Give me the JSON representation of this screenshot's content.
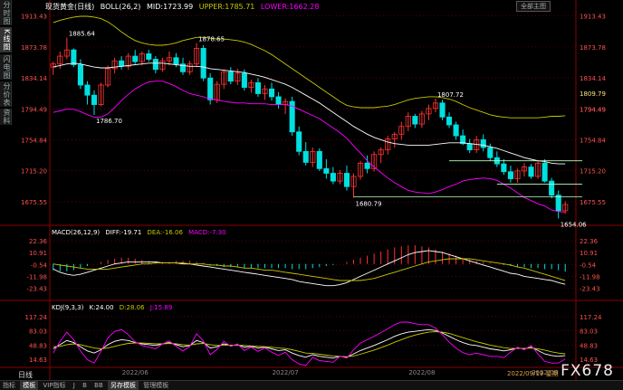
{
  "window": {
    "title": "现货黄金",
    "period": "日线",
    "main_button": "全部主图",
    "side_tabs": [
      "分时图",
      "K线图",
      "闪电图",
      "分价表",
      "资料"
    ],
    "watermark": "FX678",
    "cursor_date": "2022/09/19 星期"
  },
  "boll_header": {
    "name": "现货黄金(日线)",
    "params": "BOLL(26,2)",
    "mid": "MID:1723.99",
    "upper": "UPPER:1785.71",
    "lower": "LOWER:1662.28"
  },
  "macd_header": {
    "name": "MACD(26,12,9)",
    "diff": "DIFF:-19.71",
    "dea": "DEA:-16.06",
    "macd": "MACD:-7.30"
  },
  "kdj_header": {
    "name": "KDJ(9,3,3)",
    "k": "K:24.00",
    "d": "D:28.06",
    "j": "J:15.89"
  },
  "bottom_tabs": [
    "指标",
    "模板",
    "VIP指标",
    "J",
    "B",
    "BB",
    "另存模板",
    "管理模板"
  ],
  "colors": {
    "up": "#ff3333",
    "down": "#00e0e0",
    "mid": "#ffffff",
    "upper": "#c8c800",
    "lower": "#ff00ff",
    "grid": "#8b0000",
    "axis": "#ff5050"
  },
  "chart_data": [
    {
      "type": "candlestick",
      "title": "现货黄金(日线)",
      "ylim": [
        1650,
        1920
      ],
      "y_ticks": [
        1913.43,
        1873.78,
        1834.14,
        1794.49,
        1754.84,
        1715.2,
        1675.55
      ],
      "x_tick_labels": [
        "2022/06",
        "2022/07",
        "2022/08",
        "2022/09"
      ],
      "annotations": [
        {
          "label": "1885.64",
          "value": 1885.64
        },
        {
          "label": "1786.70",
          "value": 1786.7
        },
        {
          "label": "1878.65",
          "value": 1878.65
        },
        {
          "label": "1807.72",
          "value": 1807.72
        },
        {
          "label": "1680.79",
          "value": 1680.79
        },
        {
          "label": "1654.06",
          "value": 1654.06
        }
      ],
      "right_markers": [
        1809.79,
        1794.49
      ],
      "candles": [
        [
          1848,
          1855,
          1838,
          1852
        ],
        [
          1852,
          1868,
          1846,
          1862
        ],
        [
          1862,
          1885.64,
          1858,
          1870
        ],
        [
          1870,
          1872,
          1848,
          1851
        ],
        [
          1851,
          1858,
          1820,
          1825
        ],
        [
          1825,
          1830,
          1800,
          1812
        ],
        [
          1812,
          1818,
          1786.7,
          1800
        ],
        [
          1800,
          1828,
          1798,
          1825
        ],
        [
          1825,
          1850,
          1822,
          1846
        ],
        [
          1846,
          1860,
          1840,
          1856
        ],
        [
          1856,
          1862,
          1845,
          1849
        ],
        [
          1849,
          1866,
          1845,
          1862
        ],
        [
          1862,
          1870,
          1852,
          1855
        ],
        [
          1855,
          1868,
          1850,
          1865
        ],
        [
          1865,
          1870,
          1855,
          1858
        ],
        [
          1858,
          1862,
          1840,
          1845
        ],
        [
          1845,
          1860,
          1842,
          1856
        ],
        [
          1856,
          1868,
          1850,
          1860
        ],
        [
          1860,
          1866,
          1848,
          1852
        ],
        [
          1852,
          1860,
          1838,
          1842
        ],
        [
          1842,
          1856,
          1838,
          1852
        ],
        [
          1852,
          1878.65,
          1848,
          1872
        ],
        [
          1872,
          1876,
          1830,
          1834
        ],
        [
          1834,
          1840,
          1800,
          1806
        ],
        [
          1806,
          1830,
          1802,
          1826
        ],
        [
          1826,
          1845,
          1820,
          1842
        ],
        [
          1842,
          1848,
          1826,
          1830
        ],
        [
          1830,
          1846,
          1825,
          1840
        ],
        [
          1840,
          1845,
          1818,
          1822
        ],
        [
          1822,
          1832,
          1815,
          1828
        ],
        [
          1828,
          1834,
          1810,
          1814
        ],
        [
          1814,
          1825,
          1806,
          1820
        ],
        [
          1820,
          1828,
          1805,
          1810
        ],
        [
          1810,
          1816,
          1795,
          1800
        ],
        [
          1800,
          1808,
          1788,
          1804
        ],
        [
          1804,
          1810,
          1760,
          1765
        ],
        [
          1765,
          1772,
          1735,
          1740
        ],
        [
          1740,
          1752,
          1722,
          1726
        ],
        [
          1726,
          1745,
          1720,
          1740
        ],
        [
          1740,
          1744,
          1715,
          1718
        ],
        [
          1718,
          1730,
          1705,
          1712
        ],
        [
          1712,
          1720,
          1698,
          1702
        ],
        [
          1702,
          1716,
          1698,
          1712
        ],
        [
          1712,
          1722,
          1690,
          1695
        ],
        [
          1695,
          1712,
          1680.79,
          1708
        ],
        [
          1708,
          1728,
          1704,
          1725
        ],
        [
          1725,
          1735,
          1712,
          1718
        ],
        [
          1718,
          1740,
          1714,
          1736
        ],
        [
          1736,
          1745,
          1725,
          1742
        ],
        [
          1742,
          1760,
          1736,
          1756
        ],
        [
          1756,
          1765,
          1745,
          1762
        ],
        [
          1762,
          1778,
          1755,
          1772
        ],
        [
          1772,
          1790,
          1766,
          1785
        ],
        [
          1785,
          1788,
          1770,
          1775
        ],
        [
          1775,
          1792,
          1770,
          1788
        ],
        [
          1788,
          1800,
          1780,
          1795
        ],
        [
          1795,
          1807.72,
          1790,
          1802
        ],
        [
          1802,
          1806,
          1780,
          1784
        ],
        [
          1784,
          1790,
          1770,
          1774
        ],
        [
          1774,
          1778,
          1755,
          1760
        ],
        [
          1760,
          1768,
          1748,
          1750
        ],
        [
          1750,
          1756,
          1738,
          1742
        ],
        [
          1742,
          1760,
          1738,
          1755
        ],
        [
          1755,
          1762,
          1740,
          1745
        ],
        [
          1745,
          1750,
          1728,
          1732
        ],
        [
          1732,
          1740,
          1720,
          1724
        ],
        [
          1724,
          1730,
          1710,
          1714
        ],
        [
          1714,
          1722,
          1700,
          1705
        ],
        [
          1705,
          1718,
          1700,
          1715
        ],
        [
          1715,
          1725,
          1708,
          1720
        ],
        [
          1720,
          1724,
          1705,
          1708
        ],
        [
          1708,
          1728,
          1705,
          1725
        ],
        [
          1725,
          1730,
          1700,
          1702
        ],
        [
          1702,
          1706,
          1680,
          1684
        ],
        [
          1684,
          1690,
          1654.06,
          1664
        ],
        [
          1664,
          1676,
          1660,
          1672
        ]
      ],
      "boll": {
        "mid": [
          1848,
          1850,
          1852,
          1853,
          1852,
          1850,
          1848,
          1847,
          1847,
          1848,
          1849,
          1850,
          1851,
          1852,
          1853,
          1853,
          1853,
          1852,
          1851,
          1850,
          1849,
          1849,
          1848,
          1846,
          1845,
          1844,
          1843,
          1842,
          1841,
          1839,
          1837,
          1835,
          1832,
          1829,
          1826,
          1822,
          1817,
          1812,
          1807,
          1802,
          1796,
          1790,
          1784,
          1778,
          1772,
          1767,
          1762,
          1758,
          1755,
          1752,
          1750,
          1749,
          1748,
          1748,
          1748,
          1748,
          1749,
          1750,
          1751,
          1751,
          1751,
          1750,
          1749,
          1748,
          1746,
          1744,
          1741,
          1738,
          1735,
          1732,
          1730,
          1728,
          1727,
          1725,
          1724,
          1723.99
        ],
        "upper": [
          1905,
          1908,
          1910,
          1912,
          1913,
          1913,
          1912,
          1910,
          1906,
          1900,
          1893,
          1887,
          1882,
          1879,
          1877,
          1876,
          1876,
          1877,
          1879,
          1882,
          1884,
          1886,
          1886,
          1885,
          1884,
          1884,
          1883,
          1882,
          1880,
          1877,
          1873,
          1869,
          1864,
          1858,
          1852,
          1846,
          1840,
          1834,
          1828,
          1822,
          1816,
          1810,
          1804,
          1799,
          1797,
          1796,
          1796,
          1796,
          1797,
          1798,
          1800,
          1803,
          1806,
          1808,
          1809,
          1810,
          1810,
          1809,
          1807,
          1804,
          1800,
          1796,
          1793,
          1790,
          1787,
          1785,
          1784,
          1783,
          1783,
          1783,
          1783,
          1783,
          1784,
          1785,
          1785,
          1785.71
        ],
        "lower": [
          1790,
          1792,
          1794,
          1794,
          1791,
          1787,
          1784,
          1784,
          1788,
          1796,
          1805,
          1813,
          1820,
          1825,
          1829,
          1830,
          1830,
          1827,
          1823,
          1818,
          1814,
          1812,
          1810,
          1807,
          1806,
          1804,
          1803,
          1802,
          1802,
          1801,
          1801,
          1801,
          1800,
          1800,
          1800,
          1798,
          1794,
          1790,
          1786,
          1782,
          1776,
          1770,
          1764,
          1757,
          1747,
          1738,
          1728,
          1720,
          1713,
          1706,
          1700,
          1695,
          1690,
          1688,
          1687,
          1686,
          1688,
          1691,
          1695,
          1698,
          1702,
          1704,
          1705,
          1706,
          1705,
          1703,
          1698,
          1693,
          1687,
          1681,
          1677,
          1673,
          1670,
          1665,
          1663,
          1662.28
        ]
      }
    },
    {
      "type": "bar",
      "title": "MACD(26,12,9)",
      "ylim": [
        -30,
        26
      ],
      "y_ticks": [
        22.36,
        10.91,
        -0.54,
        -11.98,
        -23.43
      ],
      "histogram": [
        -6,
        -7,
        -7,
        -6,
        -4,
        -2,
        0,
        2,
        4,
        5,
        6,
        6,
        5,
        4,
        3,
        2,
        2,
        2,
        3,
        3,
        3,
        2,
        1,
        -1,
        -2,
        -3,
        -3,
        -3,
        -4,
        -4,
        -4,
        -4,
        -4,
        -4,
        -4,
        -5,
        -5,
        -5,
        -4,
        -3,
        -2,
        -1,
        0,
        2,
        4,
        6,
        8,
        10,
        12,
        14,
        16,
        17,
        18,
        18,
        17,
        16,
        14,
        12,
        10,
        8,
        6,
        4,
        3,
        2,
        1,
        0,
        -1,
        -2,
        -3,
        -3,
        -4,
        -4,
        -5,
        -5,
        -6,
        -7.3
      ],
      "diff": [
        -5,
        -8,
        -10,
        -11,
        -10,
        -8,
        -6,
        -4,
        -2,
        0,
        1,
        2,
        2,
        2,
        2,
        2,
        1,
        1,
        1,
        0,
        0,
        -1,
        -2,
        -3,
        -4,
        -5,
        -6,
        -7,
        -8,
        -9,
        -10,
        -11,
        -12,
        -13,
        -14,
        -15,
        -17,
        -18,
        -19,
        -20,
        -21,
        -21,
        -20,
        -18,
        -15,
        -12,
        -9,
        -6,
        -3,
        0,
        3,
        6,
        9,
        11,
        12,
        13,
        12,
        11,
        9,
        7,
        5,
        3,
        1,
        -1,
        -3,
        -5,
        -7,
        -9,
        -10,
        -12,
        -13,
        -14,
        -15,
        -16,
        -18,
        -19.71
      ],
      "dea": [
        0,
        -1,
        -2,
        -3,
        -4,
        -5,
        -5,
        -5,
        -5,
        -4,
        -3,
        -2,
        -1,
        0,
        0,
        1,
        1,
        1,
        1,
        1,
        0,
        0,
        0,
        -1,
        -1,
        -2,
        -2,
        -3,
        -4,
        -4,
        -5,
        -6,
        -6,
        -7,
        -8,
        -9,
        -10,
        -11,
        -12,
        -13,
        -14,
        -15,
        -16,
        -16,
        -16,
        -16,
        -15,
        -14,
        -12,
        -10,
        -8,
        -6,
        -4,
        -2,
        0,
        2,
        3,
        4,
        5,
        5,
        5,
        5,
        4,
        3,
        2,
        1,
        0,
        -1,
        -3,
        -4,
        -6,
        -8,
        -10,
        -12,
        -14,
        -16.06
      ]
    },
    {
      "type": "line",
      "title": "KDJ(9,3,3)",
      "ylim": [
        0,
        130
      ],
      "y_ticks": [
        117.24,
        83.03,
        48.83,
        14.63
      ],
      "k": [
        40,
        50,
        60,
        55,
        45,
        35,
        30,
        38,
        50,
        58,
        62,
        60,
        55,
        52,
        50,
        48,
        52,
        55,
        50,
        45,
        48,
        60,
        55,
        42,
        45,
        52,
        48,
        50,
        44,
        46,
        42,
        44,
        40,
        36,
        38,
        30,
        24,
        20,
        26,
        22,
        20,
        18,
        22,
        20,
        28,
        36,
        42,
        48,
        55,
        62,
        70,
        76,
        80,
        82,
        84,
        86,
        84,
        78,
        70,
        62,
        55,
        50,
        48,
        44,
        40,
        38,
        35,
        38,
        42,
        40,
        44,
        36,
        28,
        24,
        22,
        24
      ],
      "d": [
        45,
        46,
        50,
        52,
        50,
        46,
        42,
        40,
        42,
        46,
        50,
        53,
        54,
        54,
        53,
        52,
        52,
        53,
        52,
        50,
        49,
        52,
        53,
        50,
        48,
        49,
        49,
        49,
        48,
        47,
        46,
        45,
        44,
        42,
        41,
        38,
        34,
        30,
        29,
        27,
        25,
        23,
        22,
        21,
        23,
        27,
        32,
        37,
        43,
        49,
        56,
        62,
        68,
        73,
        77,
        80,
        81,
        80,
        77,
        72,
        67,
        62,
        57,
        53,
        49,
        46,
        43,
        41,
        41,
        41,
        42,
        40,
        37,
        33,
        30,
        28.06
      ],
      "j": [
        30,
        58,
        80,
        62,
        35,
        14,
        6,
        34,
        66,
        82,
        86,
        74,
        57,
        48,
        44,
        40,
        52,
        59,
        46,
        35,
        46,
        76,
        59,
        26,
        39,
        58,
        46,
        52,
        36,
        44,
        34,
        42,
        32,
        24,
        32,
        14,
        4,
        0,
        20,
        12,
        10,
        8,
        22,
        18,
        38,
        54,
        62,
        70,
        79,
        88,
        98,
        104,
        104,
        100,
        98,
        98,
        90,
        74,
        56,
        42,
        31,
        26,
        30,
        26,
        22,
        22,
        19,
        32,
        44,
        38,
        48,
        28,
        10,
        6,
        6,
        15.89
      ]
    }
  ]
}
